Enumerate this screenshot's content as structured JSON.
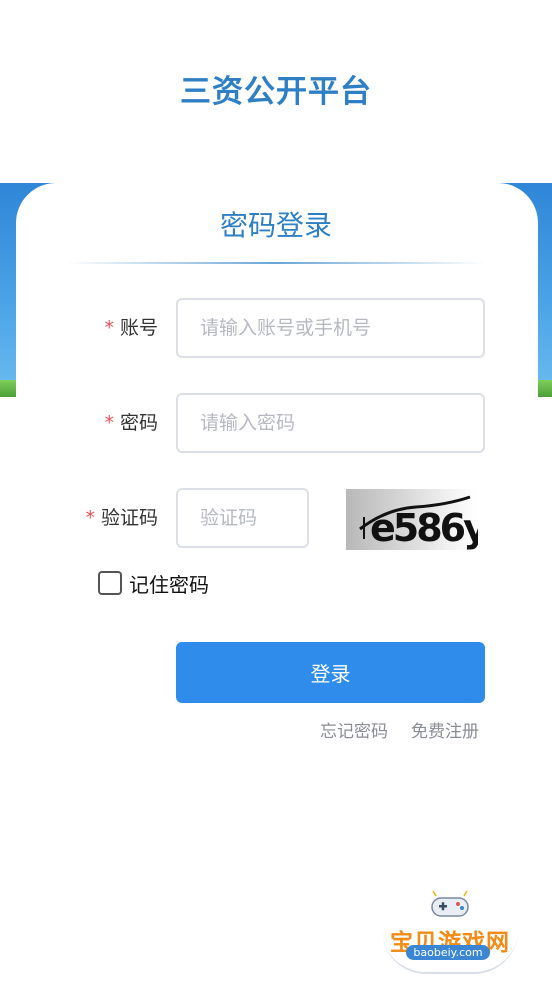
{
  "header": {
    "title": "三资公开平台"
  },
  "card": {
    "title": "密码登录"
  },
  "form": {
    "account": {
      "required_mark": "*",
      "label": "账号",
      "placeholder": "请输入账号或手机号",
      "value": ""
    },
    "password": {
      "required_mark": "*",
      "label": "密码",
      "placeholder": "请输入密码",
      "value": ""
    },
    "captcha": {
      "required_mark": "*",
      "label": "验证码",
      "placeholder": "验证码",
      "value": "",
      "image_text": "e586y"
    },
    "remember": {
      "label": "记住密码",
      "checked": false
    }
  },
  "actions": {
    "login_label": "登录",
    "forgot_label": "忘记密码",
    "register_label": "免费注册"
  },
  "watermark": {
    "text": "宝贝游戏网",
    "url": "baobeiy.com"
  },
  "colors": {
    "primary": "#2f8ceb",
    "title": "#2f7fc4",
    "required": "#e0535a"
  }
}
